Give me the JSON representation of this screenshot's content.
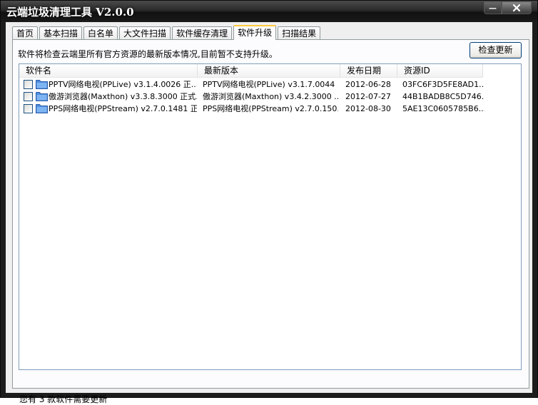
{
  "window": {
    "title": "云端垃圾清理工具 V2.0.0",
    "minimize_glyph": "—",
    "close_icon": "close-icon"
  },
  "tabs": [
    {
      "label": "首页"
    },
    {
      "label": "基本扫描"
    },
    {
      "label": "白名单"
    },
    {
      "label": "大文件扫描"
    },
    {
      "label": "软件缓存清理"
    },
    {
      "label": "软件升级",
      "active": true
    },
    {
      "label": "扫描结果"
    }
  ],
  "panel": {
    "info": "软件将检查云端里所有官方资源的最新版本情况,目前暂不支持升级。",
    "check_button": "检查更新"
  },
  "list": {
    "columns": [
      "软件名",
      "最新版本",
      "发布日期",
      "资源ID"
    ],
    "rows": [
      {
        "name": "PPTV网络电视(PPLive) v3.1.4.0026 正...",
        "latest": "PPTV网络电视(PPLive) v3.1.7.0044 ...",
        "date": "2012-06-28",
        "id": "03FC6F3D5FE8AD1...",
        "checked": false
      },
      {
        "name": "傲游浏览器(Maxthon) v3.3.8.3000 正式...",
        "latest": "傲游浏览器(Maxthon) v3.4.2.3000 ...",
        "date": "2012-07-27",
        "id": "44B1BADB8C5D746...",
        "checked": false
      },
      {
        "name": "PPS网络电视(PPStream) v2.7.0.1481 正...",
        "latest": "PPS网络电视(PPStream) v2.7.0.150...",
        "date": "2012-08-30",
        "id": "5AE13C0605785B6...",
        "checked": false
      }
    ]
  },
  "status": "您有 3 款软件需要更新",
  "colors": {
    "frame": "#1c1c1c",
    "active_tab_accent": "#ffc83c",
    "list_border": "#7f9db9",
    "folder": "#4f8fe0"
  }
}
